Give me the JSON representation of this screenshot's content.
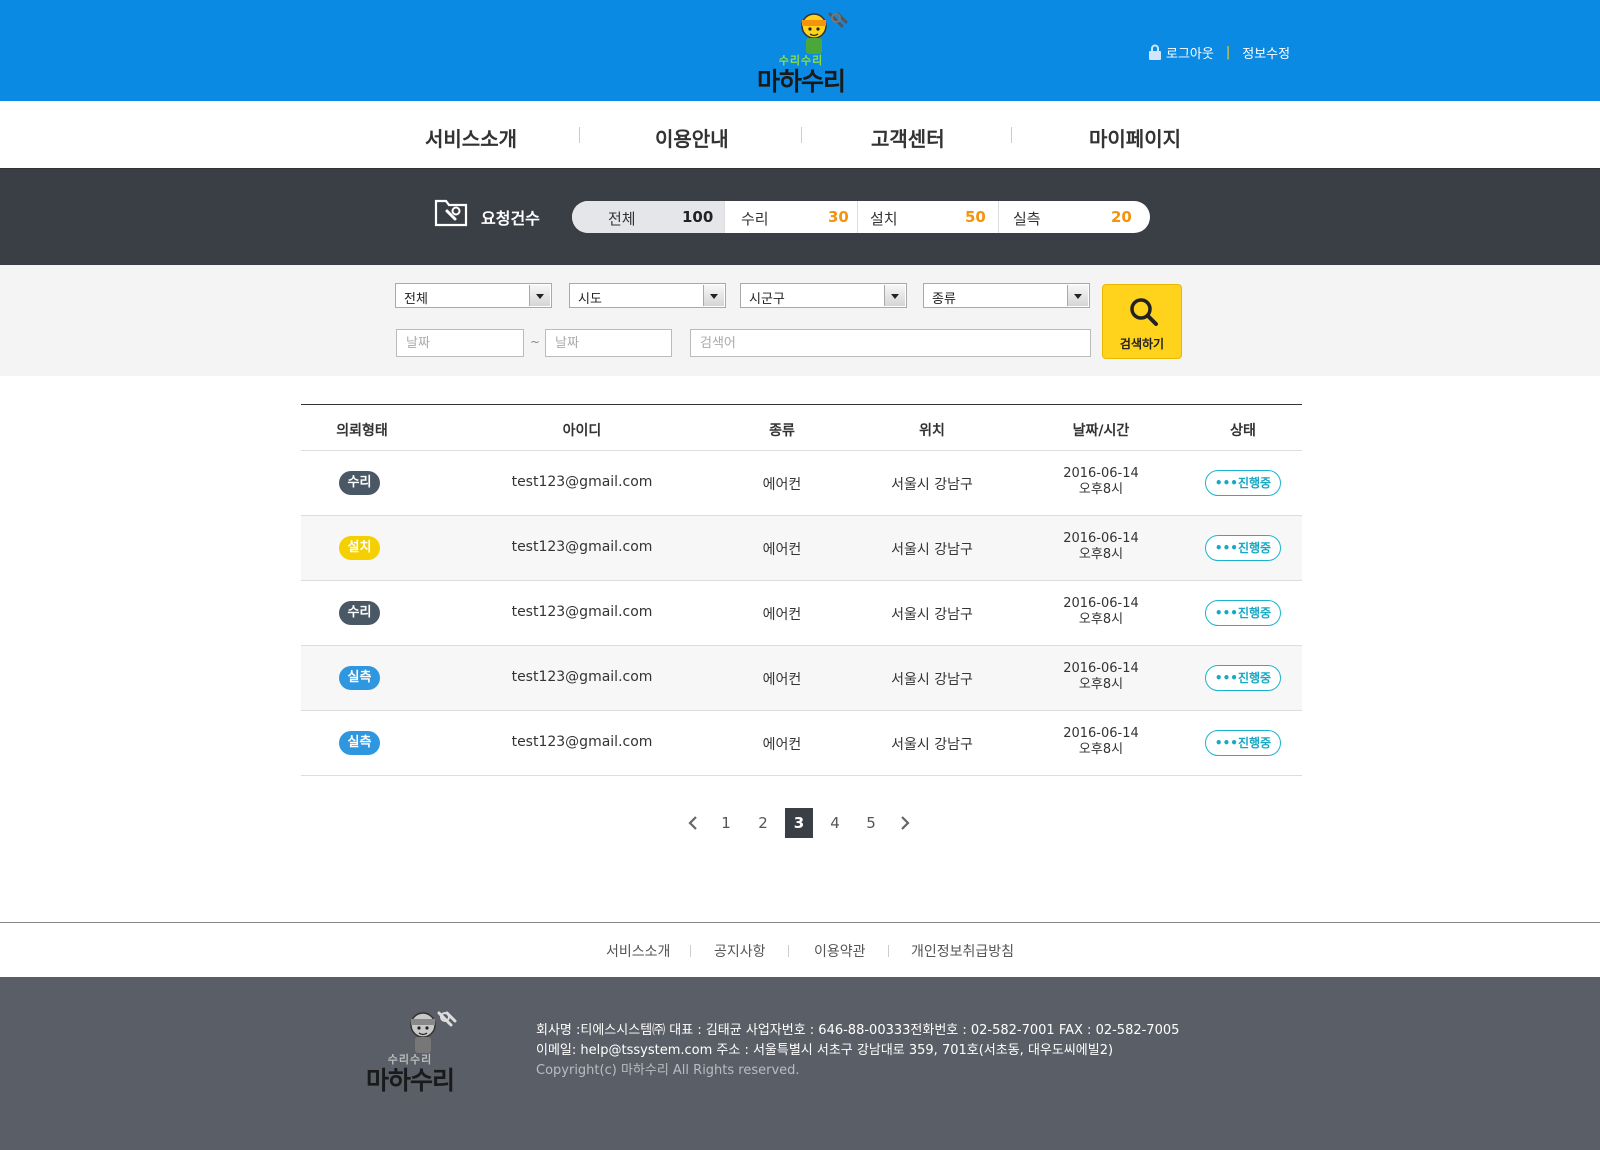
{
  "header": {
    "logo_sub": "수리수리",
    "logo_main": "마하수리",
    "logout": "로그아웃",
    "separator": "|",
    "edit_info": "정보수정"
  },
  "nav": {
    "items": [
      "서비스소개",
      "이용안내",
      "고객센터",
      "마이페이지"
    ]
  },
  "request_count": {
    "title": "요청건수",
    "total_label": "전체",
    "total_value": "100",
    "segments": [
      {
        "label": "수리",
        "value": "30"
      },
      {
        "label": "설치",
        "value": "50"
      },
      {
        "label": "실측",
        "value": "20"
      }
    ],
    "accent_color": "#f5930f"
  },
  "filters": {
    "selects": [
      "전체",
      "시도",
      "시군구",
      "종류"
    ],
    "date_from_placeholder": "날짜",
    "date_to_placeholder": "날짜",
    "tilde": "~",
    "keyword_placeholder": "검색어",
    "search_label": "검색하기"
  },
  "table": {
    "headers": [
      "의뢰형태",
      "아이디",
      "종류",
      "위치",
      "날짜/시간",
      "상태"
    ],
    "rows": [
      {
        "type": "수리",
        "type_color": "#4a5866",
        "id": "test123@gmail.com",
        "kind": "에어컨",
        "location": "서울시 강남구",
        "date": "2016-06-14",
        "time": "오후8시",
        "status": "진행중"
      },
      {
        "type": "설치",
        "type_color": "#f5d000",
        "id": "test123@gmail.com",
        "kind": "에어컨",
        "location": "서울시 강남구",
        "date": "2016-06-14",
        "time": "오후8시",
        "status": "진행중"
      },
      {
        "type": "수리",
        "type_color": "#4a5866",
        "id": "test123@gmail.com",
        "kind": "에어컨",
        "location": "서울시 강남구",
        "date": "2016-06-14",
        "time": "오후8시",
        "status": "진행중"
      },
      {
        "type": "실측",
        "type_color": "#2f97e0",
        "id": "test123@gmail.com",
        "kind": "에어컨",
        "location": "서울시 강남구",
        "date": "2016-06-14",
        "time": "오후8시",
        "status": "진행중"
      },
      {
        "type": "실측",
        "type_color": "#2f97e0",
        "id": "test123@gmail.com",
        "kind": "에어컨",
        "location": "서울시 강남구",
        "date": "2016-06-14",
        "time": "오후8시",
        "status": "진행중"
      }
    ]
  },
  "pagination": {
    "pages": [
      "1",
      "2",
      "3",
      "4",
      "5"
    ],
    "current": "3"
  },
  "footer": {
    "links": [
      "서비스소개",
      "공지사항",
      "이용약관",
      "개인정보취급방침"
    ],
    "logo_sub": "수리수리",
    "logo_main": "마하수리",
    "company_line": "회사명 :티에스시스템㈜  대표 : 김태균  사업자번호 : 646-88-00333전화번호 : 02-582-7001   FAX : 02-582-7005",
    "contact_line": "이메일: help@tssystem.com  주소 : 서울특별시 서초구 강남대로 359, 701호(서초동, 대우도씨에빌2)",
    "copyright": "Copyright(c) 마하수리  All Rights reserved."
  },
  "colors": {
    "brand_blue": "#0a8ae3",
    "dark_bar": "#3a3f46",
    "search_yellow": "#ffd21c",
    "status_cyan": "#17a8c4"
  }
}
